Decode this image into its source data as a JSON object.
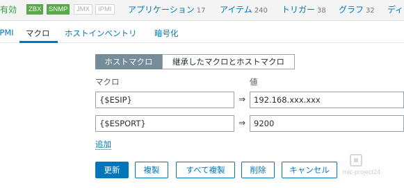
{
  "host_status": {
    "enabled": "有効",
    "zbx": "ZBX",
    "snmp": "SNMP",
    "jmx": "JMX",
    "ipmi": "IPMI"
  },
  "host_nav": [
    {
      "label": "アプリケーション",
      "count": "17"
    },
    {
      "label": "アイテム",
      "count": "240"
    },
    {
      "label": "トリガー",
      "count": "38"
    },
    {
      "label": "グラフ",
      "count": "32"
    },
    {
      "label": "ディ",
      "count": ""
    }
  ],
  "tabs": [
    {
      "label": "IPMI"
    },
    {
      "label": "マクロ",
      "active": true
    },
    {
      "label": "ホストインベントリ"
    },
    {
      "label": "暗号化"
    }
  ],
  "macro_view": {
    "host_macros": "ホストマクロ",
    "inherited_macros": "継承したマクロとホストマクロ"
  },
  "columns": {
    "macro": "マクロ",
    "value": "値"
  },
  "macros": [
    {
      "macro": "{$ESIP}",
      "arrow": "⇒",
      "value": "192.168.xxx.xxx"
    },
    {
      "macro": "{$ESPORT}",
      "arrow": "⇒",
      "value": "9200"
    }
  ],
  "add_label": "追加",
  "buttons": {
    "update": "更新",
    "clone": "複製",
    "full_clone": "すべて複製",
    "delete": "削除",
    "cancel": "キャンセル"
  },
  "watermark": "mic-project24"
}
